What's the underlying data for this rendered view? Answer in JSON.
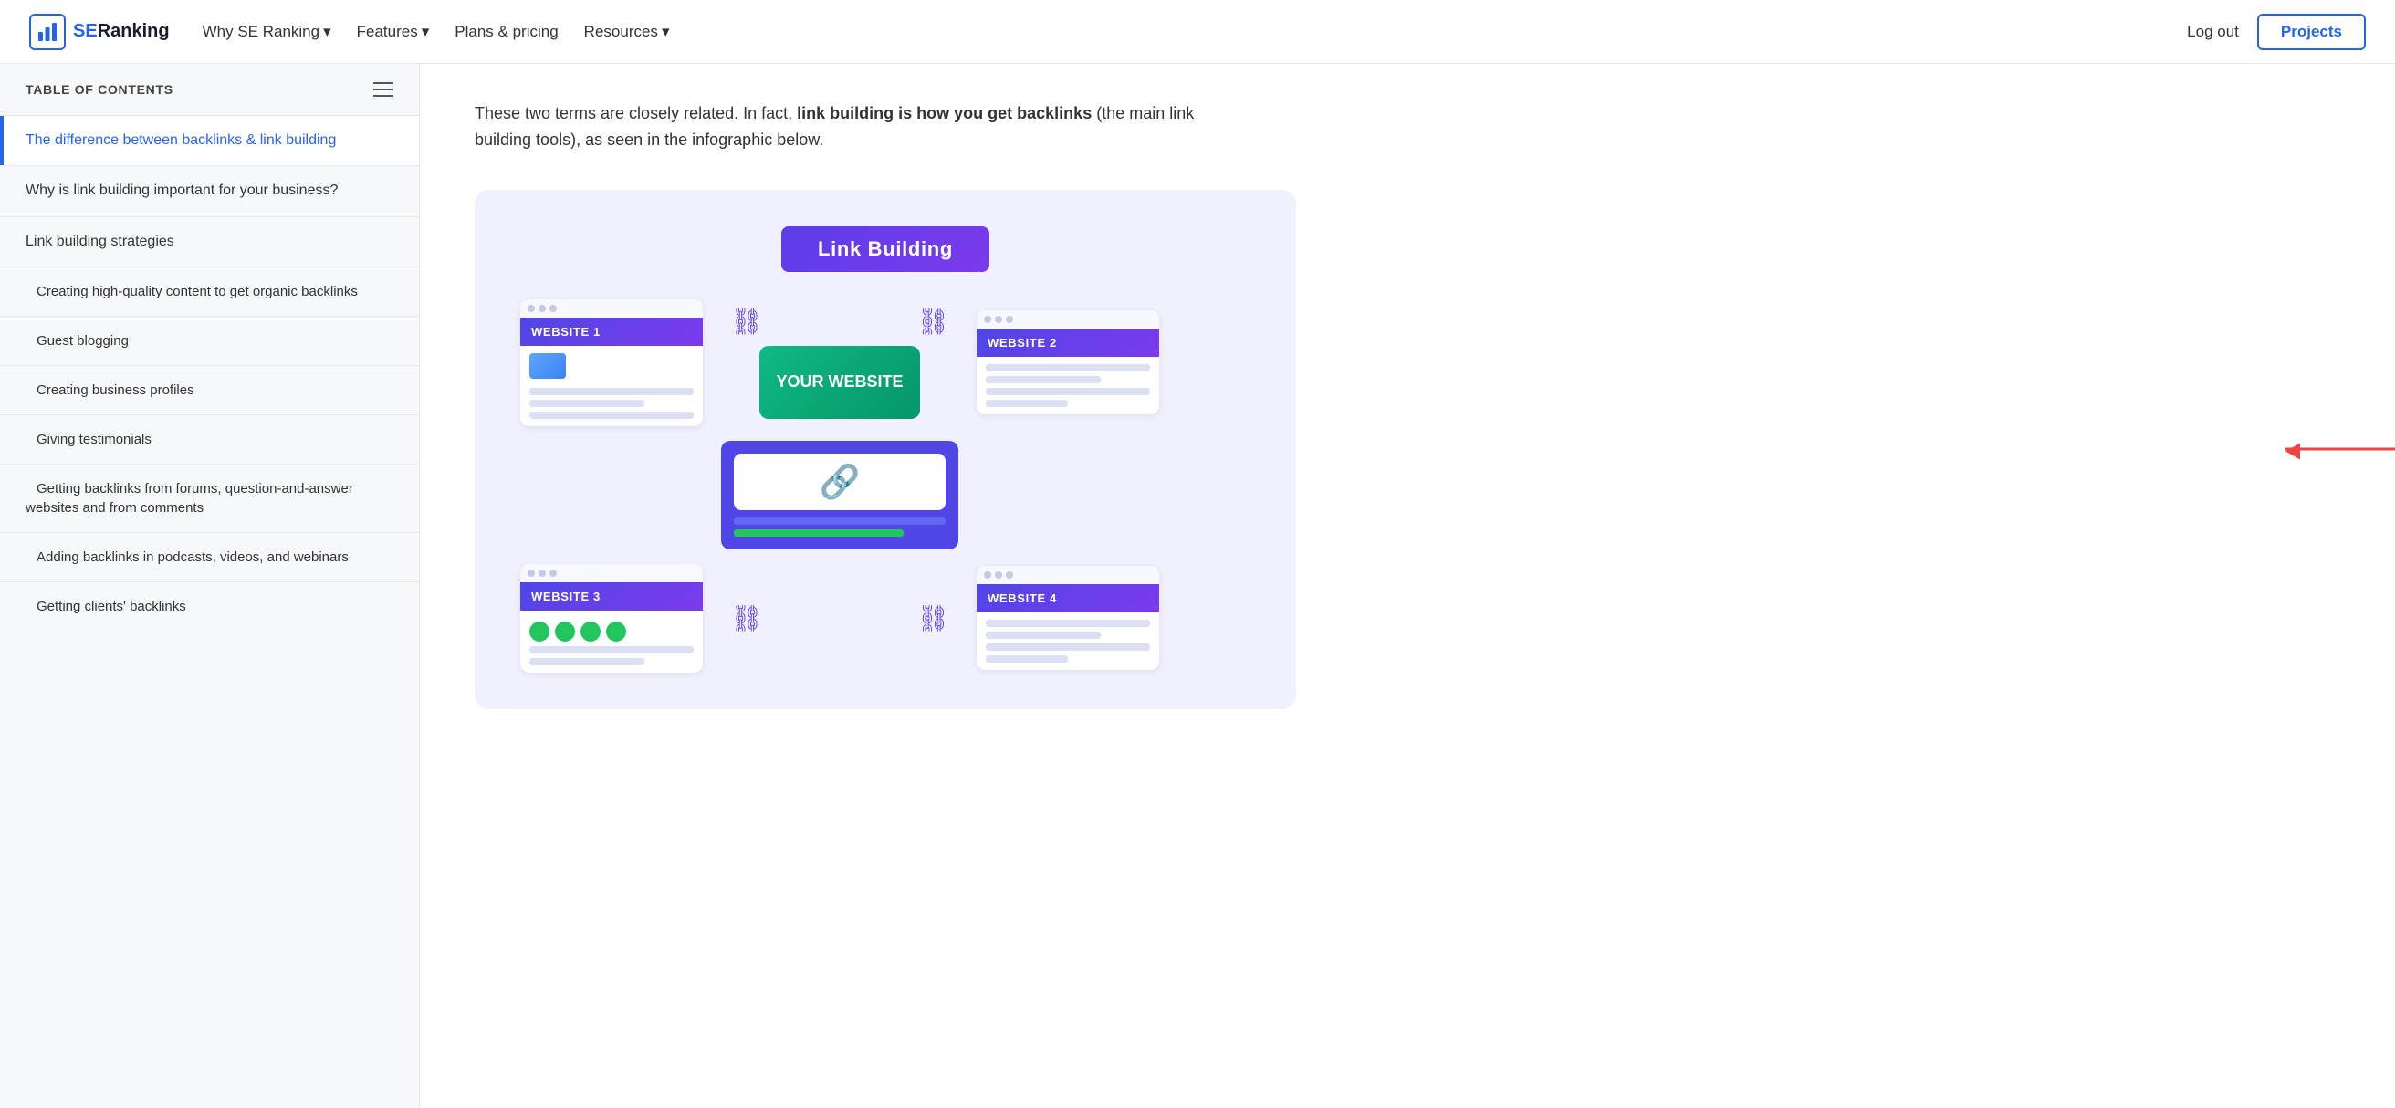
{
  "navbar": {
    "logo_se": "SE",
    "logo_ranking": "Ranking",
    "nav_items": [
      {
        "label": "Why SE Ranking",
        "has_arrow": true
      },
      {
        "label": "Features",
        "has_arrow": true
      },
      {
        "label": "Plans & pricing",
        "has_arrow": false
      },
      {
        "label": "Resources",
        "has_arrow": true
      }
    ],
    "logout_label": "Log out",
    "projects_label": "Projects"
  },
  "sidebar": {
    "toc_title": "TABLE OF CONTENTS",
    "items": [
      {
        "id": "backlinks-link",
        "text": "The difference between backlinks & link building",
        "type": "link",
        "active": true
      },
      {
        "id": "why-important",
        "text": "Why is link building important for your business?",
        "type": "main"
      },
      {
        "id": "strategies",
        "text": "Link building strategies",
        "type": "main"
      },
      {
        "id": "high-quality",
        "text": "Creating high-quality content to get organic backlinks",
        "type": "sub"
      },
      {
        "id": "guest-blogging",
        "text": "Guest blogging",
        "type": "sub"
      },
      {
        "id": "business-profiles",
        "text": "Creating business profiles",
        "type": "sub"
      },
      {
        "id": "testimonials",
        "text": "Giving testimonials",
        "type": "sub"
      },
      {
        "id": "forums",
        "text": "Getting backlinks from forums, question-and-answer websites and from comments",
        "type": "sub"
      },
      {
        "id": "podcasts",
        "text": "Adding backlinks in podcasts, videos, and webinars",
        "type": "sub"
      },
      {
        "id": "clients",
        "text": "Getting clients' backlinks",
        "type": "sub"
      }
    ]
  },
  "content": {
    "intro_text_1": "These two terms are closely related. In fact, ",
    "intro_bold": "link building is how you get backlinks",
    "intro_text_2": " (the main link building tools), as seen in the infographic below.",
    "infographic": {
      "title": "Link Building",
      "website1_label": "WEBSITE 1",
      "website2_label": "WEBSITE 2",
      "website3_label": "WEBSITE 3",
      "website4_label": "WEBSITE 4",
      "your_website_label": "YOUR WEBSITE"
    }
  }
}
